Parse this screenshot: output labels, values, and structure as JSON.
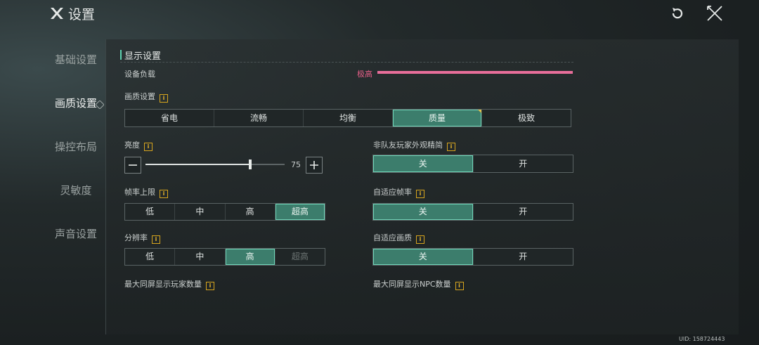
{
  "header": {
    "title": "设置",
    "reset_icon": "reset-icon",
    "close_icon": "close-icon"
  },
  "sidebar": {
    "items": [
      {
        "label": "基础设置",
        "active": false
      },
      {
        "label": "画质设置",
        "active": true
      },
      {
        "label": "操控布局",
        "active": false
      },
      {
        "label": "灵敏度",
        "active": false
      },
      {
        "label": "声音设置",
        "active": false
      }
    ]
  },
  "display": {
    "section_title": "显示设置",
    "device_load": {
      "label": "设备负载",
      "value_text": "极高",
      "fraction": 1.0
    },
    "quality": {
      "label": "画质设置",
      "options": [
        "省电",
        "流畅",
        "均衡",
        "质量",
        "极致"
      ],
      "selected": "质量"
    },
    "brightness": {
      "label": "亮度",
      "value": "75",
      "fraction": 0.75
    },
    "teammate_simplify": {
      "label": "非队友玩家外观精简",
      "options": [
        "关",
        "开"
      ],
      "selected": "关"
    },
    "frame_limit": {
      "label": "帧率上限",
      "options": [
        "低",
        "中",
        "高",
        "超高"
      ],
      "selected": "超高"
    },
    "adaptive_fps": {
      "label": "自适应帧率",
      "options": [
        "关",
        "开"
      ],
      "selected": "关"
    },
    "resolution": {
      "label": "分辨率",
      "options": [
        "低",
        "中",
        "高",
        "超高"
      ],
      "selected": "高",
      "disabled": [
        "超高"
      ]
    },
    "adaptive_quality": {
      "label": "自适应画质",
      "options": [
        "关",
        "开"
      ],
      "selected": "关"
    },
    "max_players": {
      "label": "最大同屏显示玩家数量"
    },
    "max_npc": {
      "label": "最大同屏显示NPC数量"
    }
  },
  "footer": {
    "uid": "UID: 158724443"
  },
  "colors": {
    "accent": "#3c7d6c",
    "accent_border": "#6fd6b8",
    "load": "#e86e9a",
    "info": "#e7b52a"
  }
}
